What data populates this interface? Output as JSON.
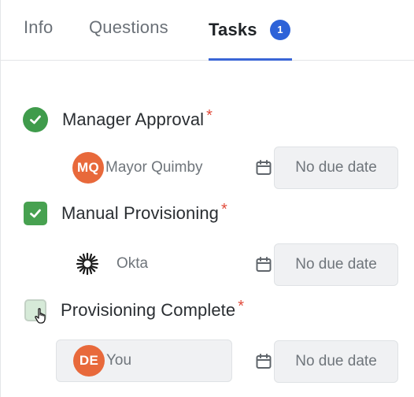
{
  "tabs": {
    "info": "Info",
    "questions": "Questions",
    "tasks": "Tasks",
    "tasks_badge": "1"
  },
  "tasks": [
    {
      "title": "Manager Approval",
      "required_mark": "*",
      "status": "completed-circle",
      "assignee_initials": "MQ",
      "assignee_name": "Mayor Quimby",
      "due": "No due date"
    },
    {
      "title": "Manual Provisioning",
      "required_mark": "*",
      "status": "checked",
      "assignee_icon": "okta-logo-icon",
      "assignee_name": "Okta",
      "due": "No due date"
    },
    {
      "title": "Provisioning Complete",
      "required_mark": "*",
      "status": "unchecked",
      "assignee_initials": "DE",
      "assignee_name": "You",
      "due": "No due date"
    }
  ],
  "colors": {
    "accent": "#2d62d8",
    "success": "#3f9b4b",
    "required": "#e14b3b",
    "avatar": "#e8693b"
  }
}
